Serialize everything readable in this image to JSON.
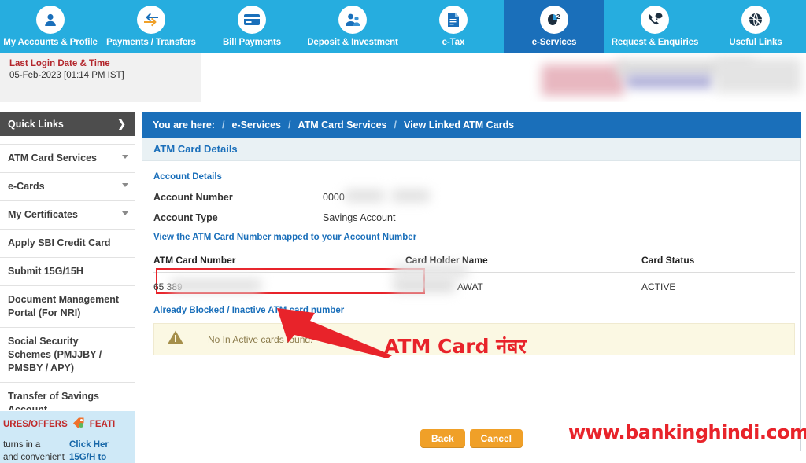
{
  "topnav": {
    "items": [
      {
        "label": "My Accounts & Profile",
        "icon": "user-icon",
        "active": false
      },
      {
        "label": "Payments / Transfers",
        "icon": "transfer-arrows-icon",
        "active": false
      },
      {
        "label": "Bill Payments",
        "icon": "card-bill-icon",
        "active": false
      },
      {
        "label": "Deposit & Investment",
        "icon": "users-deposit-icon",
        "active": false
      },
      {
        "label": "e-Tax",
        "icon": "tax-document-icon",
        "active": false
      },
      {
        "label": "e-Services",
        "icon": "mouse-services-icon",
        "active": true
      },
      {
        "label": "Request & Enquiries",
        "icon": "phone-support-icon",
        "active": false
      },
      {
        "label": "Useful Links",
        "icon": "globe-links-icon",
        "active": false
      }
    ]
  },
  "last_login": {
    "title": "Last Login Date & Time",
    "value": "05-Feb-2023 [01:14 PM IST]"
  },
  "sidebar": {
    "quick_links_title": "Quick Links",
    "chevron": "❯",
    "items": [
      {
        "label": "ATM Card Services",
        "has_caret": true
      },
      {
        "label": "e-Cards",
        "has_caret": true
      },
      {
        "label": "My Certificates",
        "has_caret": true
      },
      {
        "label": "Apply SBI Credit Card",
        "has_caret": false
      },
      {
        "label": "Submit 15G/15H",
        "has_caret": false
      },
      {
        "label": "Document Management Portal (For NRI)",
        "has_caret": false
      },
      {
        "label": "Social Security Schemes (PMJJBY / PMSBY / APY)",
        "has_caret": false
      },
      {
        "label": "Transfer of Savings Account",
        "has_caret": false
      }
    ]
  },
  "promo": {
    "headline_left": "URES/OFFERS",
    "headline_right": "FEATI",
    "line_a_1": "turns in a",
    "line_a_2": "and convenient",
    "line_b_1": "Click Her",
    "line_b_2": "15G/H to"
  },
  "breadcrumb": {
    "prefix": "You are here:",
    "separator": "/",
    "items": [
      "e-Services",
      "ATM Card Services",
      "View Linked ATM Cards"
    ]
  },
  "panel": {
    "title": "ATM Card Details",
    "account_section_label": "Account Details",
    "account_number_label": "Account Number",
    "account_number_value": "0000",
    "account_type_label": "Account Type",
    "account_type_value": "Savings Account",
    "mapped_note": "View the ATM Card Number mapped to your Account Number"
  },
  "table": {
    "headers": [
      "ATM Card Number",
      "Card Holder Name",
      "Card Status"
    ],
    "rows": [
      {
        "card_number": "65                          389",
        "holder_name": "AWAT",
        "status": "ACTIVE"
      }
    ]
  },
  "blocked_link": "Already Blocked / Inactive ATM card number",
  "alert": {
    "icon": "warning-triangle-icon",
    "message": "No In Active cards found."
  },
  "buttons": {
    "back": "Back",
    "cancel": "Cancel"
  },
  "annotations": {
    "callout": "ATM Card नंबर",
    "watermark": "www.bankinghindi.com"
  },
  "colors": {
    "nav_blue": "#26addf",
    "nav_active": "#1a6fba",
    "accent_link": "#1a6fba",
    "button_orange": "#f0a028",
    "annotation_red": "#e8232a",
    "alert_bg": "#fbf8e3"
  }
}
